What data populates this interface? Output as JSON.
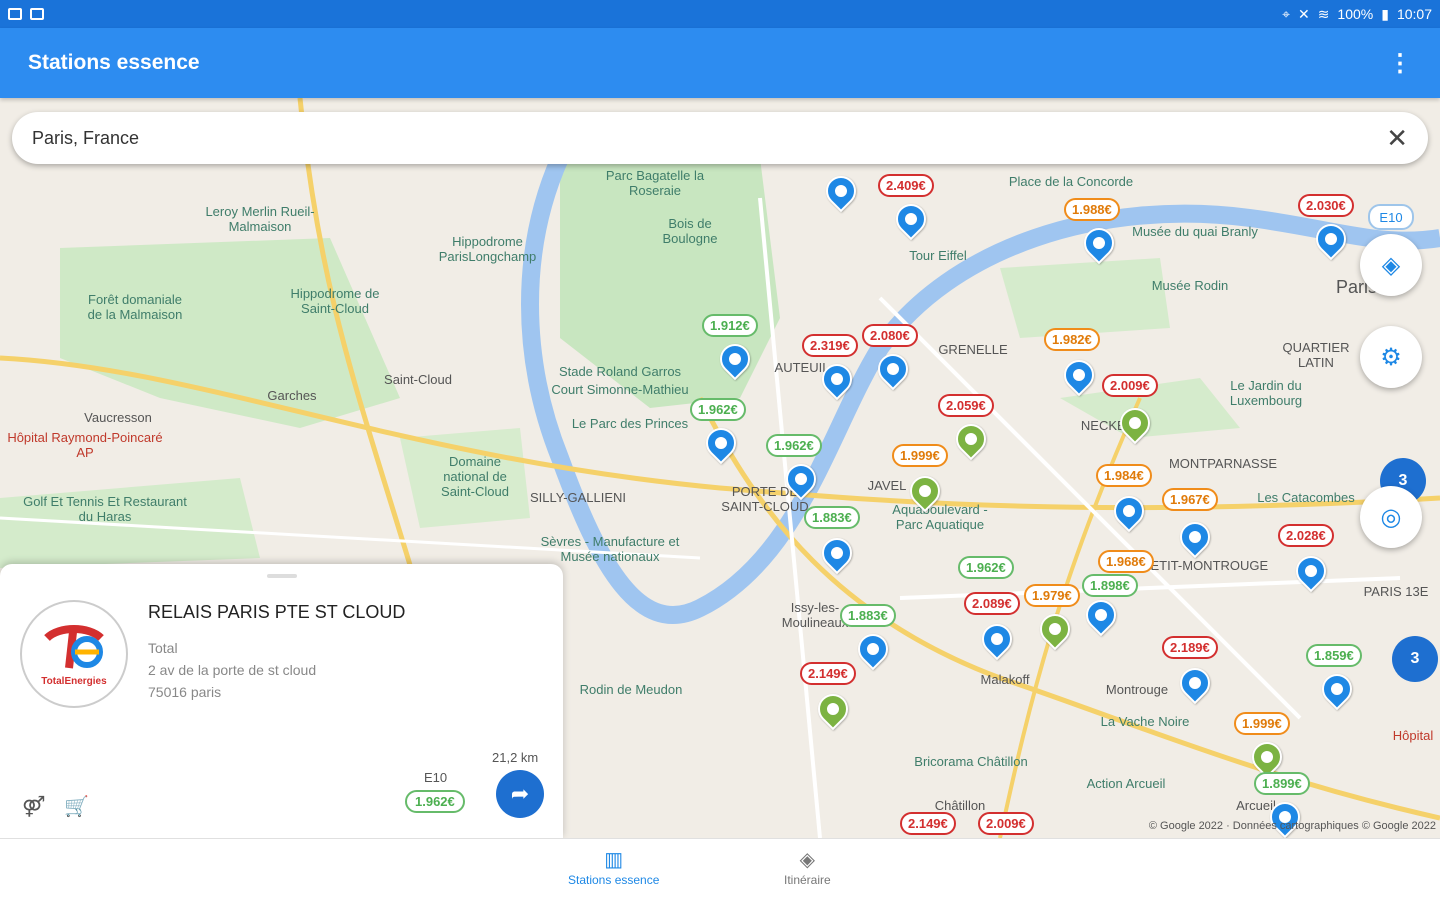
{
  "status": {
    "battery": "100%",
    "time": "10:07"
  },
  "app": {
    "title": "Stations essence"
  },
  "search": {
    "value": "Paris, France"
  },
  "map": {
    "places": [
      {
        "text": "Parc Bagatelle la Roseraie"
      },
      {
        "text": "Bois de Boulogne"
      },
      {
        "text": "Leroy Merlin Rueil-Malmaison"
      },
      {
        "text": "Hippodrome ParisLongchamp"
      },
      {
        "text": "Forêt domaniale de la Malmaison"
      },
      {
        "text": "Hippodrome de Saint-Cloud"
      },
      {
        "text": "Garches"
      },
      {
        "text": "Saint-Cloud"
      },
      {
        "text": "Stade Roland Garros"
      },
      {
        "text": "Court Simonne-Mathieu"
      },
      {
        "text": "Le Parc des Princes"
      },
      {
        "text": "Vaucresson"
      },
      {
        "text": "Hôpital Raymond-Poincaré AP"
      },
      {
        "text": "Domaine national de Saint-Cloud"
      },
      {
        "text": "SILLY-GALLIENI"
      },
      {
        "text": "Golf Et Tennis Et Restaurant du Haras"
      },
      {
        "text": "Sèvres - Manufacture et Musée nationaux"
      },
      {
        "text": "PORTE DE SAINT-CLOUD"
      },
      {
        "text": "Place de la Concorde"
      },
      {
        "text": "Tour Eiffel"
      },
      {
        "text": "Musée du quai Branly"
      },
      {
        "text": "Musée Rodin"
      },
      {
        "text": "GRENELLE"
      },
      {
        "text": "AUTEUIL"
      },
      {
        "text": "NECKER"
      },
      {
        "text": "JAVEL"
      },
      {
        "text": "MONTPARNASSE"
      },
      {
        "text": "Le Jardin du Luxembourg"
      },
      {
        "text": "QUARTIER LATIN"
      },
      {
        "text": "Aquaboulevard - Parc Aquatique"
      },
      {
        "text": "Les Catacombes"
      },
      {
        "text": "PETIT-MONTROUGE"
      },
      {
        "text": "PARIS 13E"
      },
      {
        "text": "Issy-les-Moulineaux"
      },
      {
        "text": "Malakoff"
      },
      {
        "text": "Montrouge"
      },
      {
        "text": "La Vache Noire"
      },
      {
        "text": "Rodin de Meudon"
      },
      {
        "text": "Bricorama Châtillon"
      },
      {
        "text": "Action Arcueil"
      },
      {
        "text": "Arcueil"
      },
      {
        "text": "Châtillon"
      },
      {
        "text": "Hôpital"
      },
      {
        "text": "Paris"
      }
    ],
    "prices": [
      {
        "text": "2.409€",
        "color": "red"
      },
      {
        "text": "1.988€",
        "color": "orange"
      },
      {
        "text": "2.030€",
        "color": "red"
      },
      {
        "text": "1.912€",
        "color": "green"
      },
      {
        "text": "2.319€",
        "color": "red"
      },
      {
        "text": "2.080€",
        "color": "red"
      },
      {
        "text": "1.982€",
        "color": "orange"
      },
      {
        "text": "2.009€",
        "color": "red"
      },
      {
        "text": "2.059€",
        "color": "red"
      },
      {
        "text": "1.962€",
        "color": "green"
      },
      {
        "text": "1.962€",
        "color": "green"
      },
      {
        "text": "1.999€",
        "color": "orange"
      },
      {
        "text": "1.984€",
        "color": "orange"
      },
      {
        "text": "1.967€",
        "color": "orange"
      },
      {
        "text": "1.883€",
        "color": "green"
      },
      {
        "text": "2.028€",
        "color": "red"
      },
      {
        "text": "1.962€",
        "color": "green"
      },
      {
        "text": "1.968€",
        "color": "orange"
      },
      {
        "text": "2.089€",
        "color": "red"
      },
      {
        "text": "1.979€",
        "color": "orange"
      },
      {
        "text": "1.898€",
        "color": "green"
      },
      {
        "text": "1.883€",
        "color": "green"
      },
      {
        "text": "2.189€",
        "color": "red"
      },
      {
        "text": "1.859€",
        "color": "green"
      },
      {
        "text": "2.149€",
        "color": "red"
      },
      {
        "text": "1.999€",
        "color": "orange"
      },
      {
        "text": "1.899€",
        "color": "green"
      },
      {
        "text": "2.149€",
        "color": "red"
      },
      {
        "text": "2.009€",
        "color": "red"
      }
    ],
    "fuel_chip": "E10",
    "clusters": [
      "3",
      "3"
    ],
    "copyright": "© Google 2022 · Données cartographiques © Google 2022"
  },
  "station": {
    "brand_logo_text": "TotalEnergies",
    "name": "RELAIS PARIS PTE ST CLOUD",
    "brand": "Total",
    "address_line1": "2 av de la porte de st cloud",
    "address_line2": "75016 paris",
    "fuel_label": "E10",
    "fuel_price": "1.962€",
    "distance": "21,2 km"
  },
  "nav": {
    "items": [
      {
        "label": "Stations essence",
        "active": true
      },
      {
        "label": "Itinéraire",
        "active": false
      }
    ]
  },
  "colors": {
    "primary": "#2d8cf0",
    "accent": "#1e88e5",
    "red": "#d32f2f",
    "orange": "#f08c1a",
    "green": "#66bb6a"
  }
}
